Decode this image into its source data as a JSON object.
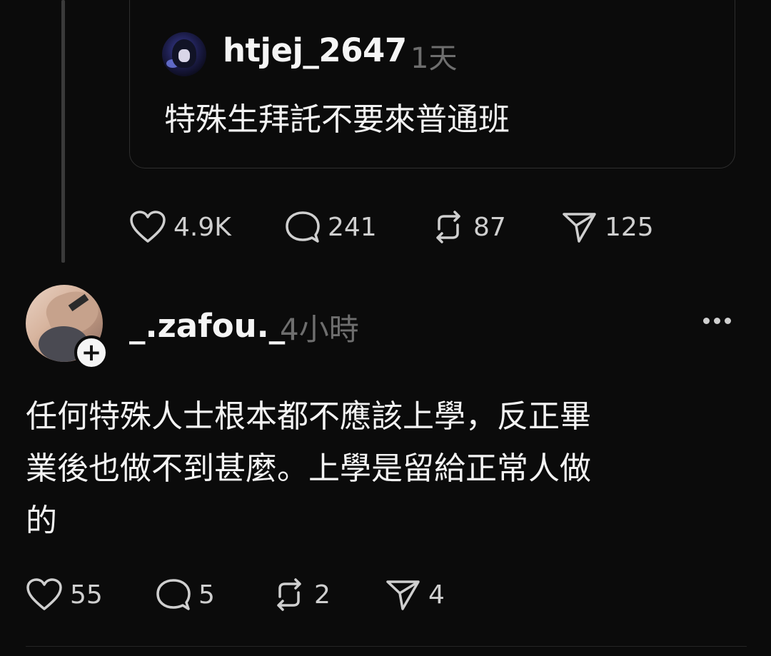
{
  "quoted_post": {
    "username": "htjej_2647",
    "time": "1天",
    "text": "特殊生拜託不要來普通班",
    "avatar_icon": "anime-avatar-icon"
  },
  "parent_actions": {
    "likes": "4.9K",
    "replies": "241",
    "reposts": "87",
    "shares": "125"
  },
  "reply_post": {
    "username": "_.zafou._",
    "time": "4小時",
    "text": "任何特殊人士根本都不應該上學，反正畢\n業後也做不到甚麼。上學是留給正常人做\n的",
    "follow_icon": "+",
    "more_icon": "more-dots-icon"
  },
  "reply_actions": {
    "likes": "55",
    "replies": "5",
    "reposts": "2",
    "shares": "4"
  },
  "colors": {
    "background": "#0b0b0b",
    "text": "#f3f3f3",
    "muted": "#6e6e6e",
    "border": "#2e2e2e"
  }
}
